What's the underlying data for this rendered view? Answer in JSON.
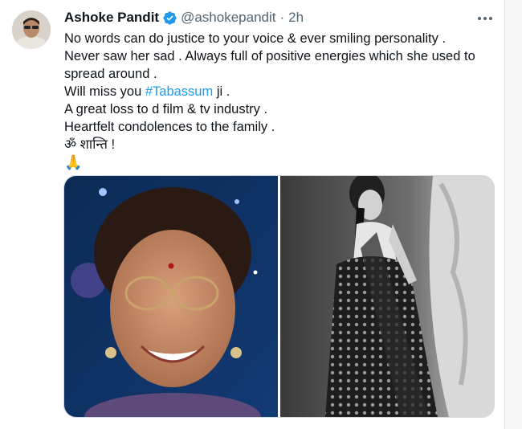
{
  "author": {
    "name": "Ashoke Pandit",
    "handle": "@ashokepandit",
    "separator": "·",
    "time": "2h"
  },
  "tweet": {
    "line1": "No words can do justice to your voice & ever smiling personality .",
    "line2": "Never saw her sad . Always full of positive energies which she used to",
    "line3": "spread around .",
    "line4_before": "Will miss you ",
    "line4_hashtag": "#Tabassum",
    "line4_after": " ji .",
    "line5": "A great loss to d film & tv industry .",
    "line6": "Heartfelt condolences to the family .",
    "line7": "ॐ शान्ति !",
    "line8": "🙏"
  },
  "icons": {
    "verified": "verified-badge-icon",
    "more": "more-options-icon"
  },
  "colors": {
    "accent": "#1d9bf0",
    "text": "#0f1419",
    "muted": "#536471"
  }
}
